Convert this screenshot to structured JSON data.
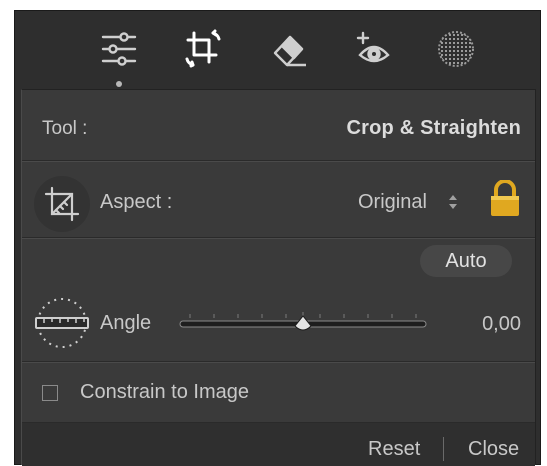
{
  "toolstrip": {
    "tools": [
      {
        "icon": "sliders-icon"
      },
      {
        "icon": "crop-icon"
      },
      {
        "icon": "eraser-icon"
      },
      {
        "icon": "redeye-icon"
      },
      {
        "icon": "mask-icon"
      }
    ]
  },
  "panel": {
    "tool_label": "Tool :",
    "tool_value": "Crop & Straighten",
    "aspect_label": "Aspect :",
    "aspect_value": "Original",
    "auto_label": "Auto",
    "angle_label": "Angle",
    "angle_value": "0,00",
    "constrain_label": "Constrain to Image",
    "reset_label": "Reset",
    "close_label": "Close"
  },
  "colors": {
    "background": "#3a3a3a",
    "toolstrip": "#2e2e2e",
    "lock": "#e0a820"
  }
}
